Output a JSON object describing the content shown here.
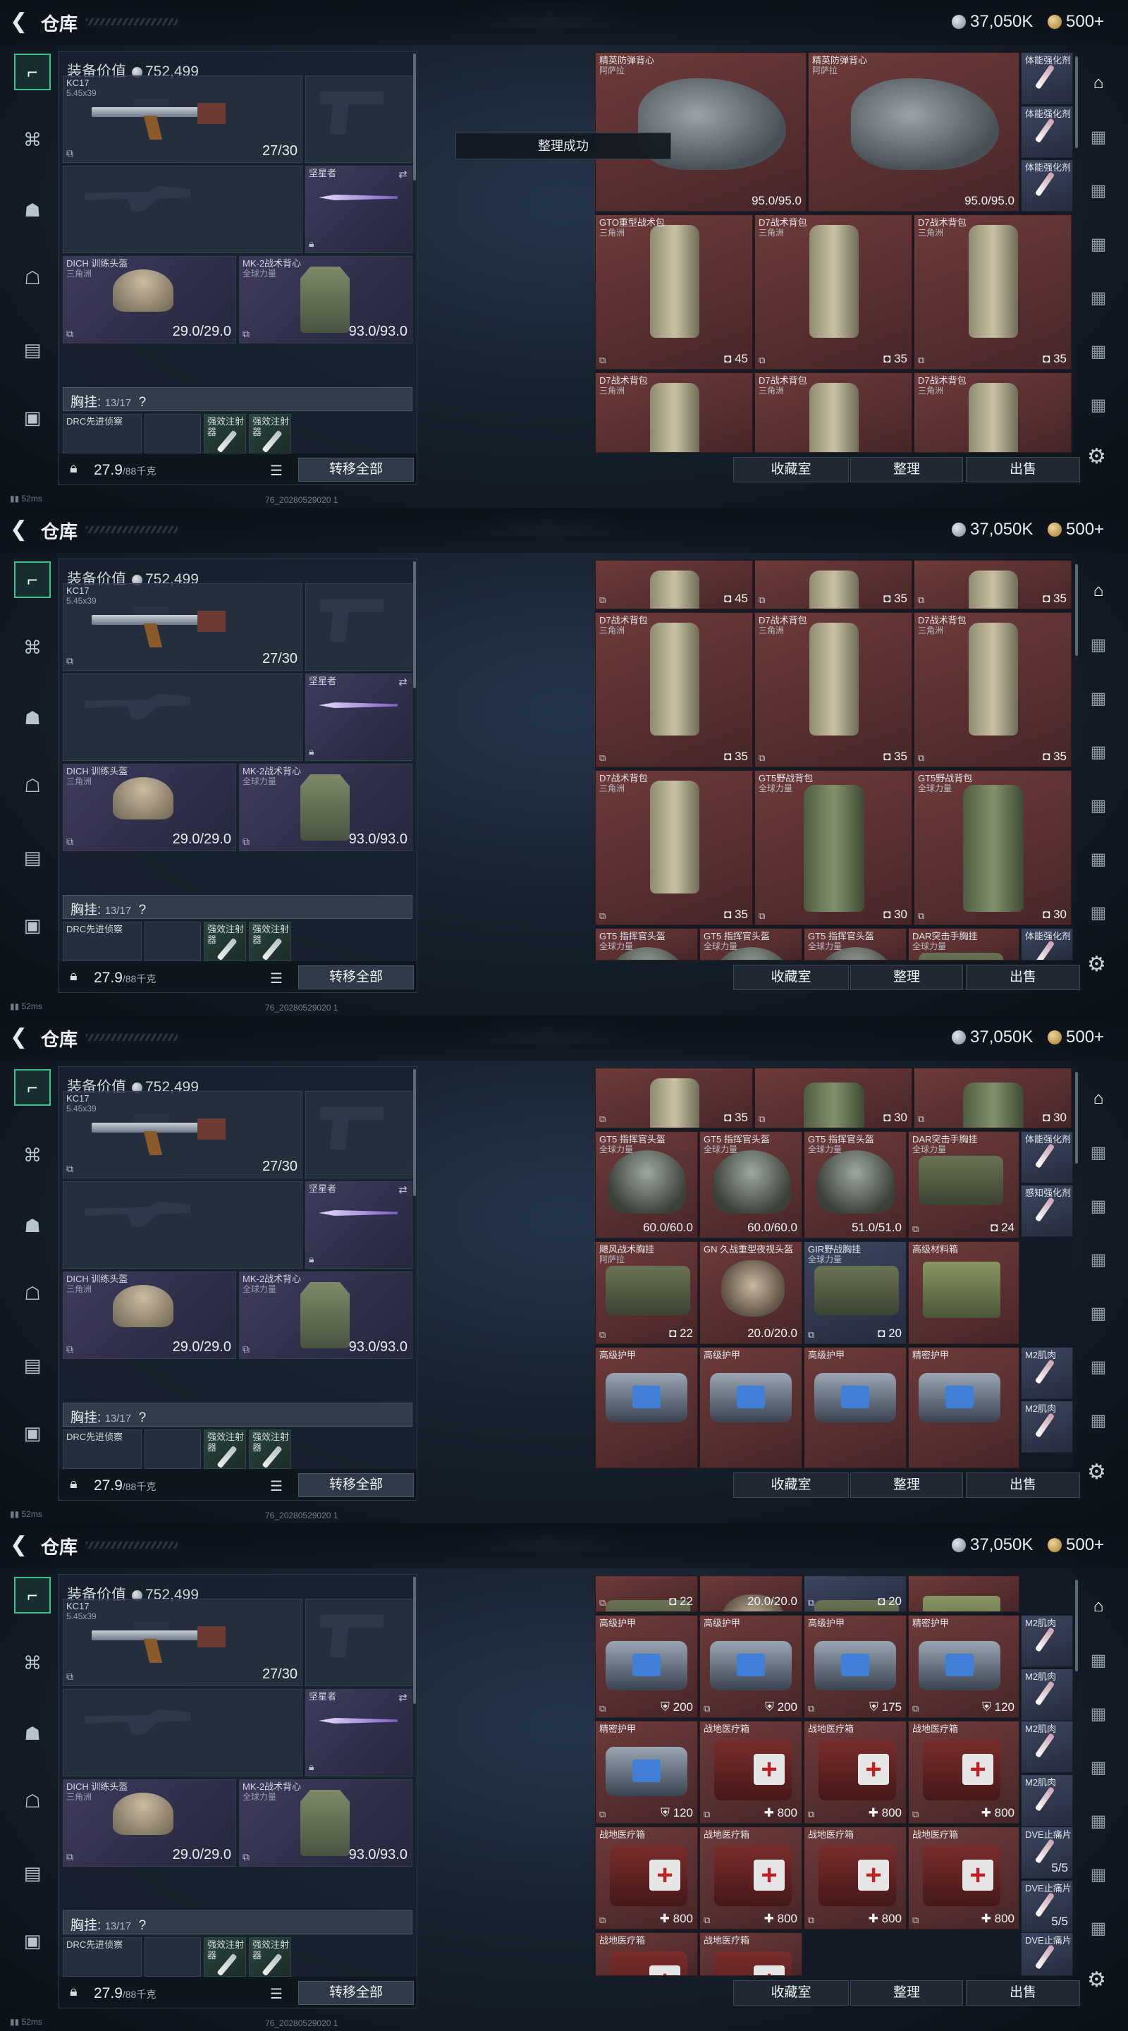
{
  "header": {
    "title": "仓库",
    "silver": "37,050K",
    "gold": "500+"
  },
  "equipment": {
    "value_label": "装备价值",
    "value": "752,499",
    "primary": {
      "name": "KC17",
      "caliber": "5.45x39",
      "ammo": "27/30"
    },
    "melee": {
      "name": "坚星者"
    },
    "helmet": {
      "name": "DICH 训练头盔",
      "sub": "三角洲",
      "durability": "29.0/29.0"
    },
    "armor": {
      "name": "MK-2战术背心",
      "sub": "全球力量",
      "durability": "93.0/93.0"
    },
    "chest_label": "胸挂:",
    "chest_value": "13/17",
    "chest_help": "?",
    "chest_items": [
      "DRC先进侦察",
      "强效注射器",
      "强效注射器"
    ],
    "weight": "27.9",
    "weight_max": "/88千克",
    "transfer_all": "转移全部"
  },
  "status": {
    "ping": "52ms",
    "version": "76_20280529020 1"
  },
  "toast": "整理成功",
  "inventory_buttons": [
    "收藏室",
    "整理",
    "出售"
  ],
  "frames": [
    {
      "items": [
        {
          "name": "精英防弹背心",
          "sub": "阿萨拉",
          "count": "95.0/95.0",
          "color": "r",
          "pic": "armor"
        },
        {
          "name": "精英防弹背心",
          "sub": "阿萨拉",
          "count": "95.0/95.0",
          "color": "r",
          "pic": "armor"
        },
        {
          "name": "体能强化剂",
          "sub": "",
          "count": "",
          "color": "b",
          "pic": "inj"
        },
        {
          "name": "体能强化剂",
          "sub": "",
          "count": "",
          "color": "b",
          "pic": "inj"
        },
        {
          "name": "体能强化剂",
          "sub": "",
          "count": "",
          "color": "b",
          "pic": "inj"
        },
        {
          "name": "GTO重型战术包",
          "sub": "三角洲",
          "count": "45",
          "color": "r",
          "pic": "pack"
        },
        {
          "name": "D7战术背包",
          "sub": "三角洲",
          "count": "35",
          "color": "r",
          "pic": "pack"
        },
        {
          "name": "D7战术背包",
          "sub": "三角洲",
          "count": "35",
          "color": "r",
          "pic": "pack"
        },
        {
          "name": "D7战术背包",
          "sub": "三角洲",
          "count": "",
          "color": "r",
          "pic": "pack"
        },
        {
          "name": "D7战术背包",
          "sub": "三角洲",
          "count": "",
          "color": "r",
          "pic": "pack"
        },
        {
          "name": "D7战术背包",
          "sub": "三角洲",
          "count": "",
          "color": "r",
          "pic": "pack"
        }
      ]
    },
    {
      "items": [
        {
          "name": "",
          "sub": "",
          "count": "45",
          "color": "r",
          "pic": "pack"
        },
        {
          "name": "",
          "sub": "",
          "count": "35",
          "color": "r",
          "pic": "pack"
        },
        {
          "name": "",
          "sub": "",
          "count": "35",
          "color": "r",
          "pic": "pack"
        },
        {
          "name": "D7战术背包",
          "sub": "三角洲",
          "count": "35",
          "color": "r",
          "pic": "pack"
        },
        {
          "name": "D7战术背包",
          "sub": "三角洲",
          "count": "35",
          "color": "r",
          "pic": "pack"
        },
        {
          "name": "D7战术背包",
          "sub": "三角洲",
          "count": "35",
          "color": "r",
          "pic": "pack"
        },
        {
          "name": "D7战术背包",
          "sub": "三角洲",
          "count": "35",
          "color": "r",
          "pic": "pack"
        },
        {
          "name": "GT5野战背包",
          "sub": "全球力量",
          "count": "30",
          "color": "r",
          "pic": "gpack"
        },
        {
          "name": "GT5野战背包",
          "sub": "全球力量",
          "count": "30",
          "color": "r",
          "pic": "gpack"
        },
        {
          "name": "GT5 指挥官头盔",
          "sub": "全球力量",
          "count": "",
          "color": "r",
          "pic": "helm"
        },
        {
          "name": "GT5 指挥官头盔",
          "sub": "全球力量",
          "count": "",
          "color": "r",
          "pic": "helm"
        },
        {
          "name": "GT5 指挥官头盔",
          "sub": "全球力量",
          "count": "",
          "color": "r",
          "pic": "helm"
        },
        {
          "name": "DAR突击手胸挂",
          "sub": "全球力量",
          "count": "",
          "color": "r",
          "pic": "rig"
        },
        {
          "name": "体能强化剂",
          "sub": "",
          "count": "",
          "color": "b",
          "pic": "inj"
        }
      ]
    },
    {
      "items": [
        {
          "name": "",
          "sub": "",
          "count": "35",
          "color": "r",
          "pic": "pack"
        },
        {
          "name": "",
          "sub": "",
          "count": "30",
          "color": "r",
          "pic": "gpack"
        },
        {
          "name": "",
          "sub": "",
          "count": "30",
          "color": "r",
          "pic": "gpack"
        },
        {
          "name": "GT5 指挥官头盔",
          "sub": "全球力量",
          "count": "60.0/60.0",
          "color": "r",
          "pic": "helm"
        },
        {
          "name": "GT5 指挥官头盔",
          "sub": "全球力量",
          "count": "60.0/60.0",
          "color": "r",
          "pic": "helm"
        },
        {
          "name": "GT5 指挥官头盔",
          "sub": "全球力量",
          "count": "51.0/51.0",
          "color": "r",
          "pic": "helm"
        },
        {
          "name": "DAR突击手胸挂",
          "sub": "全球力量",
          "count": "24",
          "color": "r",
          "pic": "rig"
        },
        {
          "name": "体能强化剂",
          "sub": "",
          "count": "",
          "color": "b",
          "pic": "inj"
        },
        {
          "name": "感知强化剂",
          "sub": "",
          "count": "",
          "color": "b",
          "pic": "inj"
        },
        {
          "name": "飓风战术胸挂",
          "sub": "阿萨拉",
          "count": "22",
          "color": "r",
          "pic": "rig"
        },
        {
          "name": "GN 久战重型夜视头盔",
          "sub": "",
          "count": "20.0/20.0",
          "color": "r",
          "pic": "nvg"
        },
        {
          "name": "GIR野战胸挂",
          "sub": "全球力量",
          "count": "20",
          "color": "b",
          "pic": "rig"
        },
        {
          "name": "高级材料箱",
          "sub": "",
          "count": "",
          "color": "r",
          "pic": "box"
        },
        {
          "name": "高级护甲",
          "sub": "",
          "count": "",
          "color": "r",
          "pic": "plate"
        },
        {
          "name": "高级护甲",
          "sub": "",
          "count": "",
          "color": "r",
          "pic": "plate"
        },
        {
          "name": "高级护甲",
          "sub": "",
          "count": "",
          "color": "r",
          "pic": "plate"
        },
        {
          "name": "精密护甲",
          "sub": "",
          "count": "",
          "color": "r",
          "pic": "plate"
        },
        {
          "name": "M2肌肉",
          "sub": "",
          "count": "",
          "color": "b",
          "pic": "inj"
        },
        {
          "name": "M2肌肉",
          "sub": "",
          "count": "",
          "color": "b",
          "pic": "inj"
        }
      ]
    },
    {
      "items": [
        {
          "name": "",
          "sub": "",
          "count": "22",
          "color": "r",
          "pic": "rig"
        },
        {
          "name": "",
          "sub": "",
          "count": "20.0/20.0",
          "color": "r",
          "pic": "nvg"
        },
        {
          "name": "",
          "sub": "",
          "count": "20",
          "color": "b",
          "pic": "rig"
        },
        {
          "name": "",
          "sub": "",
          "count": "",
          "color": "r",
          "pic": "box"
        },
        {
          "name": "高级护甲",
          "sub": "",
          "count": "200",
          "color": "r",
          "pic": "plate"
        },
        {
          "name": "高级护甲",
          "sub": "",
          "count": "200",
          "color": "r",
          "pic": "plate"
        },
        {
          "name": "高级护甲",
          "sub": "",
          "count": "175",
          "color": "r",
          "pic": "plate"
        },
        {
          "name": "精密护甲",
          "sub": "",
          "count": "120",
          "color": "r",
          "pic": "plate"
        },
        {
          "name": "M2肌肉",
          "sub": "",
          "count": "",
          "color": "b",
          "pic": "inj"
        },
        {
          "name": "M2肌肉",
          "sub": "",
          "count": "",
          "color": "b",
          "pic": "inj"
        },
        {
          "name": "精密护甲",
          "sub": "",
          "count": "120",
          "color": "r",
          "pic": "plate"
        },
        {
          "name": "战地医疗箱",
          "sub": "",
          "count": "800",
          "color": "r",
          "pic": "med"
        },
        {
          "name": "战地医疗箱",
          "sub": "",
          "count": "800",
          "color": "r",
          "pic": "med"
        },
        {
          "name": "战地医疗箱",
          "sub": "",
          "count": "800",
          "color": "r",
          "pic": "med"
        },
        {
          "name": "M2肌肉",
          "sub": "",
          "count": "",
          "color": "b",
          "pic": "inj"
        },
        {
          "name": "M2肌肉",
          "sub": "",
          "count": "",
          "color": "b",
          "pic": "inj"
        },
        {
          "name": "战地医疗箱",
          "sub": "",
          "count": "800",
          "color": "r",
          "pic": "med"
        },
        {
          "name": "战地医疗箱",
          "sub": "",
          "count": "800",
          "color": "r",
          "pic": "med"
        },
        {
          "name": "战地医疗箱",
          "sub": "",
          "count": "800",
          "color": "r",
          "pic": "med"
        },
        {
          "name": "战地医疗箱",
          "sub": "",
          "count": "800",
          "color": "r",
          "pic": "med"
        },
        {
          "name": "DVE止痛片",
          "sub": "",
          "count": "5/5",
          "color": "b",
          "pic": "inj"
        },
        {
          "name": "DVE止痛片",
          "sub": "",
          "count": "5/5",
          "color": "b",
          "pic": "inj"
        },
        {
          "name": "战地医疗箱",
          "sub": "",
          "count": "",
          "color": "r",
          "pic": "med"
        },
        {
          "name": "战地医疗箱",
          "sub": "",
          "count": "",
          "color": "r",
          "pic": "med"
        },
        {
          "name": "DVE止痛片",
          "sub": "",
          "count": "",
          "color": "b",
          "pic": "inj"
        }
      ]
    }
  ]
}
